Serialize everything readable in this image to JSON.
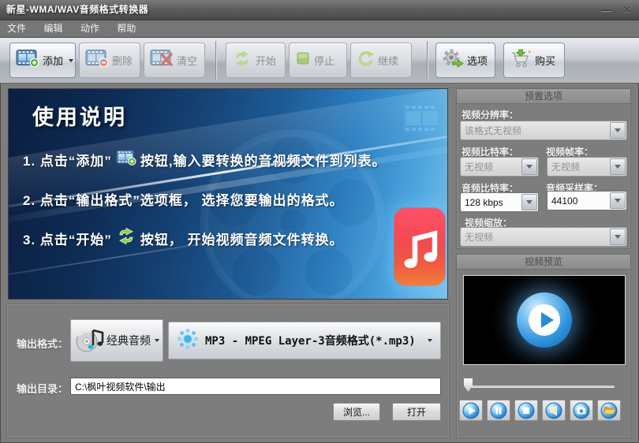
{
  "window": {
    "title": "新星-WMA/WAV音频格式转换器",
    "minimize_glyph": "—",
    "close_glyph": "✕"
  },
  "menu": {
    "items": [
      "文件",
      "编辑",
      "动作",
      "帮助"
    ]
  },
  "toolbar": {
    "add_label": "添加",
    "delete_label": "删除",
    "clear_label": "清空",
    "start_label": "开始",
    "stop_label": "停止",
    "resume_label": "继续",
    "options_label": "选项",
    "buy_label": "购买"
  },
  "instructions": {
    "title": "使用说明",
    "step1_pre": "1. 点击“添加”",
    "step1_post": "按钮,输入要转换的音视频文件到列表。",
    "step2": "2. 点击“输出格式”选项框， 选择您要输出的格式。",
    "step3_pre": "3. 点击“开始”",
    "step3_post": "按钮， 开始视频音频文件转换。"
  },
  "preset": {
    "title": "预置选项",
    "video_resolution_label": "视频分辨率：",
    "video_resolution_value": "该格式无视频",
    "video_bitrate_label": "视频比特率：",
    "video_bitrate_value": "无视频",
    "video_framerate_label": "视频帧率：",
    "video_framerate_value": "无视频",
    "audio_bitrate_label": "音频比特率：",
    "audio_bitrate_value": "128 kbps",
    "audio_samplerate_label": "音频采样率：",
    "audio_samplerate_value": "44100",
    "video_scale_label": "视频缩放：",
    "video_scale_value": "无视频"
  },
  "preview": {
    "title": "视频预览"
  },
  "output": {
    "format_label": "输出格式：",
    "category_value": "经典音频",
    "format_value": "MP3 - MPEG Layer-3音频格式(*.mp3)",
    "dir_label": "输出目录：",
    "dir_value": "C:\\枫叶视频软件\\输出",
    "browse_label": "浏览...",
    "open_label": "打开"
  },
  "colors": {
    "accent_blue": "#2e8fd8",
    "window_gray": "#7d7d7d",
    "action_green": "#76c32e",
    "music_badge_red": "#f24a50"
  }
}
